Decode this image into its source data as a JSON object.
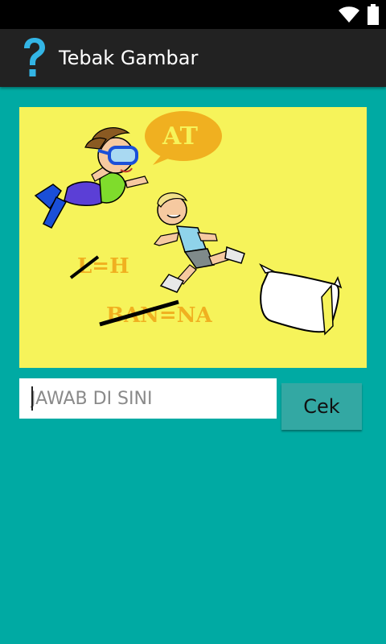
{
  "status_bar": {
    "icons": [
      "wifi-icon",
      "battery-icon"
    ]
  },
  "header": {
    "icon": "question-mark-icon",
    "title": "Tebak Gambar"
  },
  "puzzle": {
    "image_texts": {
      "bubble": "AT",
      "clue_line1": "L=H",
      "clue_line2": "BAN=NA"
    }
  },
  "answer": {
    "placeholder": "JAWAB DI SINI",
    "value": ""
  },
  "check_button": {
    "label": "Cek"
  },
  "colors": {
    "background": "#00aaa3",
    "action_bar": "#222222",
    "accent_icon": "#33b5e5",
    "image_bg": "#f6f35a",
    "clue_text": "#f0b020"
  }
}
